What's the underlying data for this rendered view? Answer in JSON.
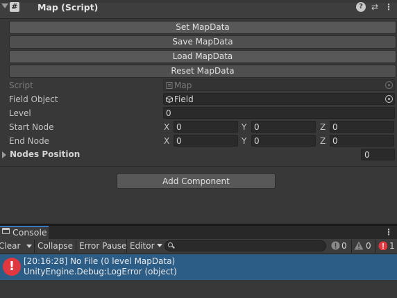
{
  "inspector": {
    "component_title": "Map (Script)",
    "buttons": [
      "Set MapData",
      "Save MapData",
      "Load MapData",
      "Reset MapData"
    ],
    "props": {
      "script_label": "Script",
      "script_value": "Map",
      "field_object_label": "Field Object",
      "field_object_value": "Field",
      "level_label": "Level",
      "level_value": "0",
      "start_node_label": "Start Node",
      "start_node": {
        "x": "0",
        "y": "0",
        "z": "0"
      },
      "end_node_label": "End Node",
      "end_node": {
        "x": "0",
        "y": "0",
        "z": "0"
      },
      "axis_x": "X",
      "axis_y": "Y",
      "axis_z": "Z",
      "nodes_position_label": "Nodes Position",
      "nodes_position_count": "0"
    },
    "add_component_label": "Add Component",
    "icons": {
      "script": "script-icon",
      "help": "help-icon",
      "preset": "preset-icon",
      "menu": "kebab-menu-icon"
    }
  },
  "console": {
    "tab_title": "Console",
    "toolbar": {
      "clear": "Clear",
      "collapse": "Collapse",
      "error_pause": "Error Pause",
      "editor": "Editor",
      "search_placeholder": ""
    },
    "counts": {
      "info": "0",
      "warning": "0",
      "error": "1"
    },
    "log": [
      {
        "line1": "[20:16:28] No File (0 level MapData)",
        "line2": "UnityEngine.Debug:LogError (object)"
      }
    ],
    "colors": {
      "selected_row": "#2c5d87",
      "error": "#e0383e",
      "tab_accent": "#3a79bb"
    }
  }
}
